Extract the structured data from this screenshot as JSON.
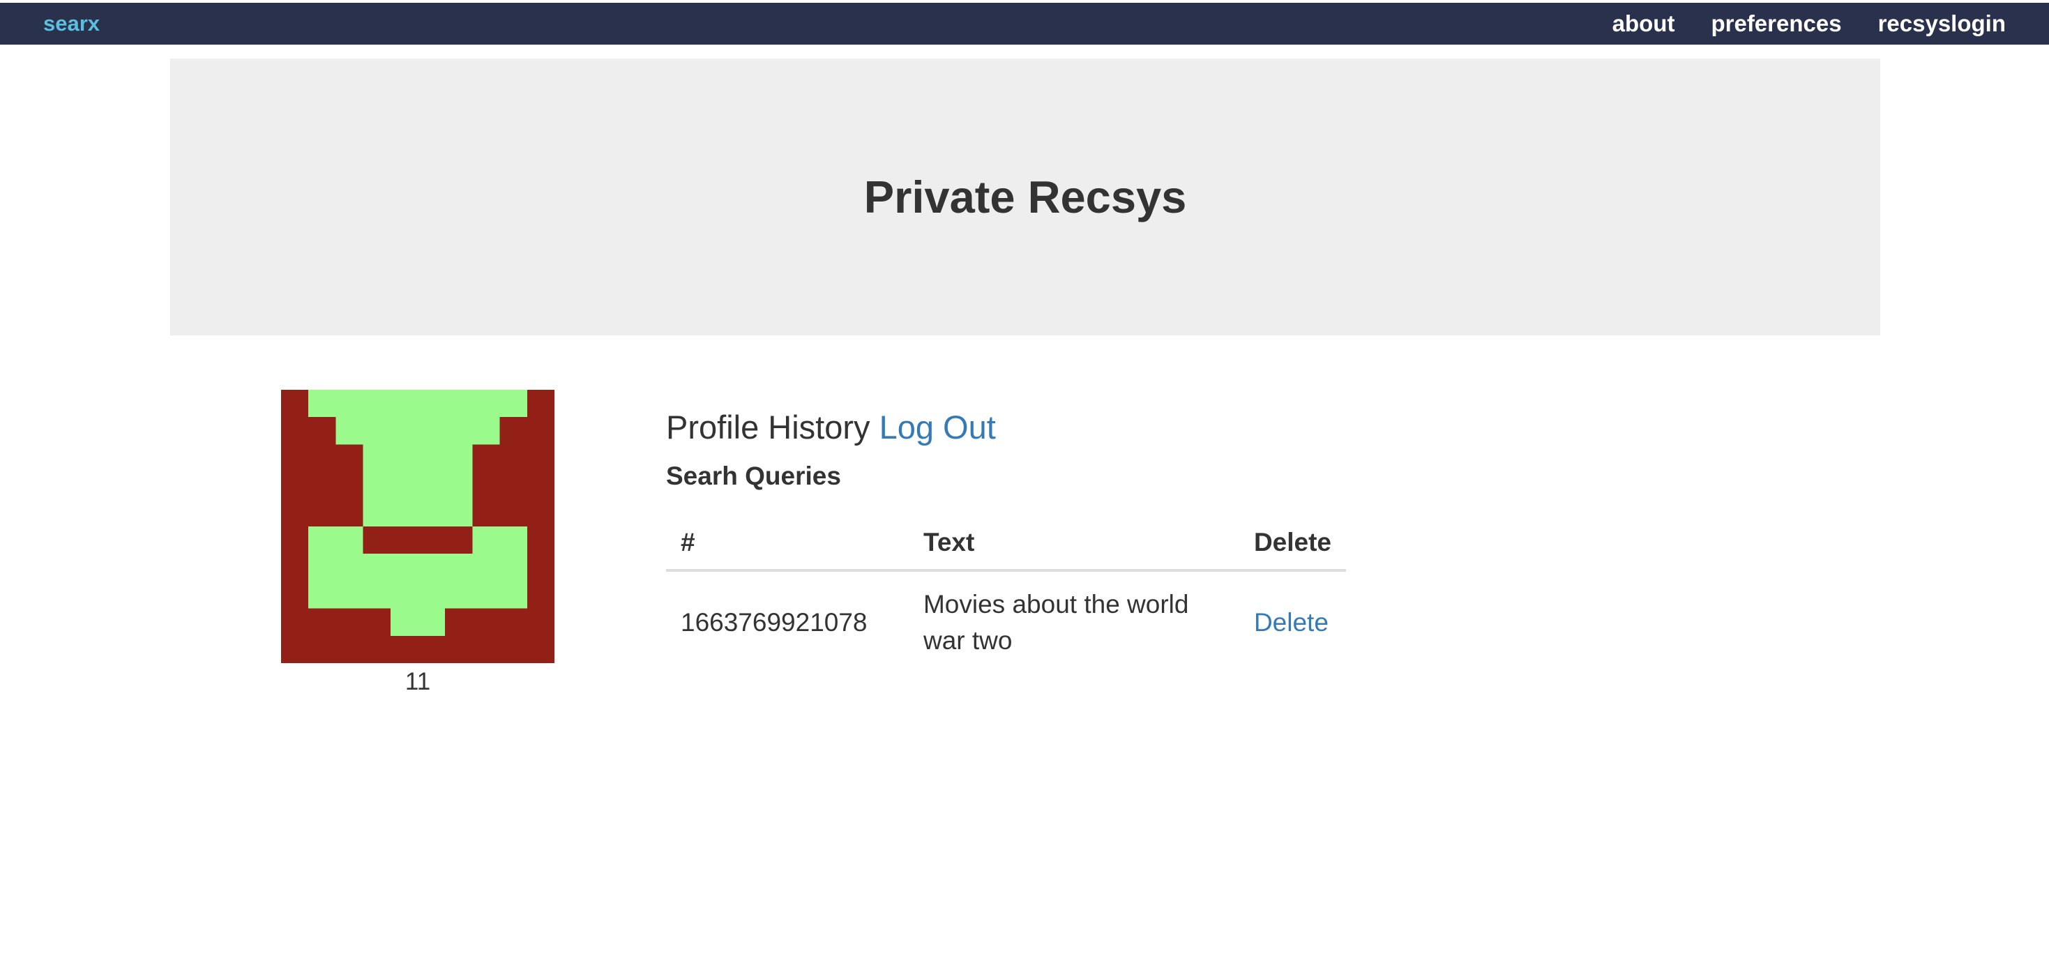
{
  "navbar": {
    "brand": "searx",
    "links": [
      "about",
      "preferences",
      "recsyslogin"
    ]
  },
  "jumbotron": {
    "title": "Private Recsys"
  },
  "profile": {
    "avatar_id": "11",
    "avatar_colors": {
      "background": "#922016",
      "foreground": "#9afa8c"
    }
  },
  "history": {
    "title": "Profile History",
    "logout_label": "Log Out",
    "queries_title": "Searh Queries",
    "columns": [
      "#",
      "Text",
      "Delete"
    ],
    "rows": [
      {
        "id": "1663769921078",
        "text": "Movies about the world war two",
        "action": "Delete"
      }
    ]
  }
}
